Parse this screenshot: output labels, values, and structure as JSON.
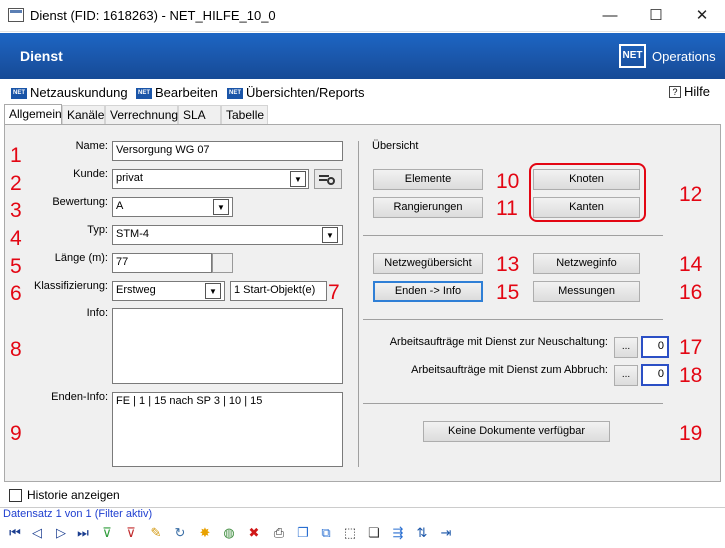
{
  "window": {
    "title": "Dienst (FID: 1618263) - NET_HILFE_10_0",
    "minimize": "—",
    "maximize": "☐",
    "close": "✕"
  },
  "header": {
    "title": "Dienst",
    "logo": "NET",
    "brand": "Operations"
  },
  "menu": {
    "items": [
      "Netzauskundung",
      "Bearbeiten",
      "Übersichten/Reports"
    ],
    "icon_text": "NET",
    "help": "Hilfe"
  },
  "tabs": [
    "Allgemein",
    "Kanäle",
    "Verrechnung",
    "SLA",
    "Tabelle"
  ],
  "form": {
    "name_label": "Name:",
    "name_value": "Versorgung WG 07",
    "kunde_label": "Kunde:",
    "kunde_value": "privat",
    "bewertung_label": "Bewertung:",
    "bewertung_value": "A",
    "typ_label": "Typ:",
    "typ_value": "STM-4",
    "laenge_label": "Länge (m):",
    "laenge_value": "77",
    "klass_label": "Klassifizierung:",
    "klass_value": "Erstweg",
    "start_objekt": "1 Start-Objekt(e)",
    "info_label": "Info:",
    "info_value": "",
    "enden_label": "Enden-Info:",
    "enden_value": "FE | 1 | 15 nach SP 3 | 10 | 15"
  },
  "overview": {
    "title": "Übersicht",
    "elemente": "Elemente",
    "knoten": "Knoten",
    "rangierungen": "Rangierungen",
    "kanten": "Kanten",
    "netzwegubersicht": "Netzwegübersicht",
    "netzweginfo": "Netzweginfo",
    "enden_info": "Enden -> Info",
    "messungen": "Messungen",
    "auftr_neu_label": "Arbeitsaufträge mit Dienst zur Neuschaltung:",
    "auftr_neu_btn": "...",
    "auftr_neu_count": "0",
    "auftr_abbr_label": "Arbeitsaufträge mit Dienst zum Abbruch:",
    "auftr_abbr_btn": "...",
    "auftr_abbr_count": "0",
    "dokumente": "Keine Dokumente verfügbar"
  },
  "annotations": [
    "1",
    "2",
    "3",
    "4",
    "5",
    "6",
    "7",
    "8",
    "9",
    "10",
    "11",
    "12",
    "13",
    "14",
    "15",
    "16",
    "17",
    "18",
    "19"
  ],
  "footer": {
    "history_label": "Historie anzeigen",
    "record_status": "Datensatz 1 von 1 (Filter aktiv)"
  },
  "colors": {
    "accent": "#1a55a8",
    "annotation": "#e30613",
    "focus": "#2f7fd6"
  }
}
